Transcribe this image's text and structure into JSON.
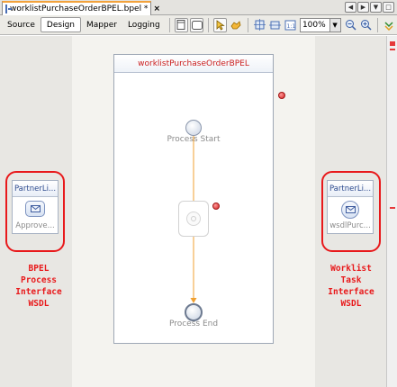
{
  "editor_tab": {
    "title": "worklistPurchaseOrderBPEL.bpel *",
    "close_glyph": "×",
    "icon": "bpel-file-icon"
  },
  "tab_nav": [
    "◀",
    "▶",
    "▼",
    "□"
  ],
  "toolbar": {
    "modes": [
      "Source",
      "Design",
      "Mapper",
      "Logging"
    ],
    "active_mode": "Design",
    "zoom": "100%"
  },
  "process": {
    "name": "worklistPurchaseOrderBPEL",
    "start_label": "Process Start",
    "end_label": "Process End"
  },
  "left_partner": {
    "header": "PartnerLi...",
    "label": "Approve...",
    "annotation": "BPEL\nProcess\nInterface\nWSDL"
  },
  "right_partner": {
    "header": "PartnerLi...",
    "label": "wsdlPurc...",
    "annotation": "Worklist\nTask\nInterface\nWSDL"
  },
  "colors": {
    "annotation_red": "#e8191b",
    "connector_orange": "#f0a030",
    "process_title_red": "#cc1f1f"
  }
}
